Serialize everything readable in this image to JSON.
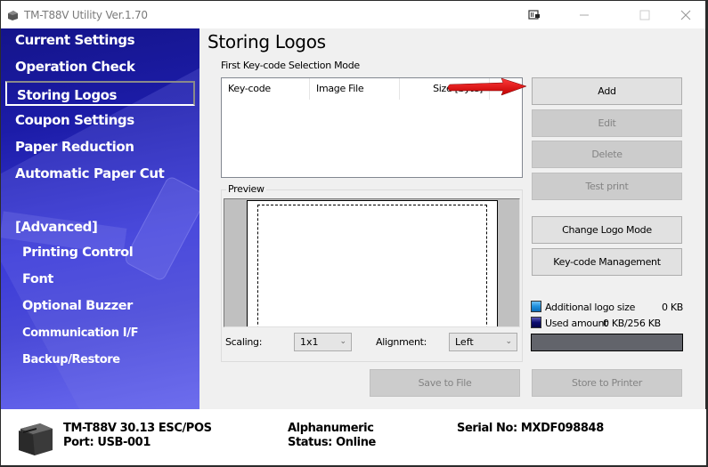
{
  "window": {
    "title": "TM-T88V Utility Ver.1.70"
  },
  "sidebar": {
    "items": [
      {
        "label": "Current Settings",
        "selected": false
      },
      {
        "label": "Operation Check",
        "selected": false
      },
      {
        "label": "Storing Logos",
        "selected": true
      },
      {
        "label": "Coupon Settings",
        "selected": false
      },
      {
        "label": "Paper Reduction",
        "selected": false
      },
      {
        "label": "Automatic Paper Cut",
        "selected": false
      }
    ],
    "advanced_header": "[Advanced]",
    "advanced_items": [
      {
        "label": "Printing Control"
      },
      {
        "label": "Font"
      },
      {
        "label": "Optional Buzzer"
      },
      {
        "label": "Communication I/F"
      },
      {
        "label": "Backup/Restore"
      }
    ]
  },
  "main": {
    "title": "Storing Logos",
    "mode_label": "First Key-code Selection Mode",
    "list": {
      "columns": [
        "Key-code",
        "Image File",
        "Size [byte]"
      ],
      "rows": []
    },
    "buttons": {
      "add": "Add",
      "edit": "Edit",
      "delete": "Delete",
      "test_print": "Test print",
      "change_logo_mode": "Change Logo Mode",
      "keycode_management": "Key-code Management",
      "save_to_file": "Save to File",
      "store_to_printer": "Store to Printer"
    },
    "preview": {
      "label": "Preview",
      "scaling_label": "Scaling:",
      "scaling_value": "1x1",
      "alignment_label": "Alignment:",
      "alignment_value": "Left"
    },
    "usage": {
      "additional_label": "Additional logo size",
      "additional_value": "0 KB",
      "additional_color": "#1e8fdc",
      "used_label": "Used amount",
      "used_value": "0 KB/256 KB",
      "used_color": "#0a0a6e",
      "used_fraction": 0
    }
  },
  "status": {
    "model": "TM-T88V 30.13 ESC/POS",
    "port": "Port: USB-001",
    "charset": "Alphanumeric",
    "status": "Status: Online",
    "serial": "Serial No: MXDF098848"
  },
  "annotation": {
    "arrow_color": "#e8141a"
  }
}
